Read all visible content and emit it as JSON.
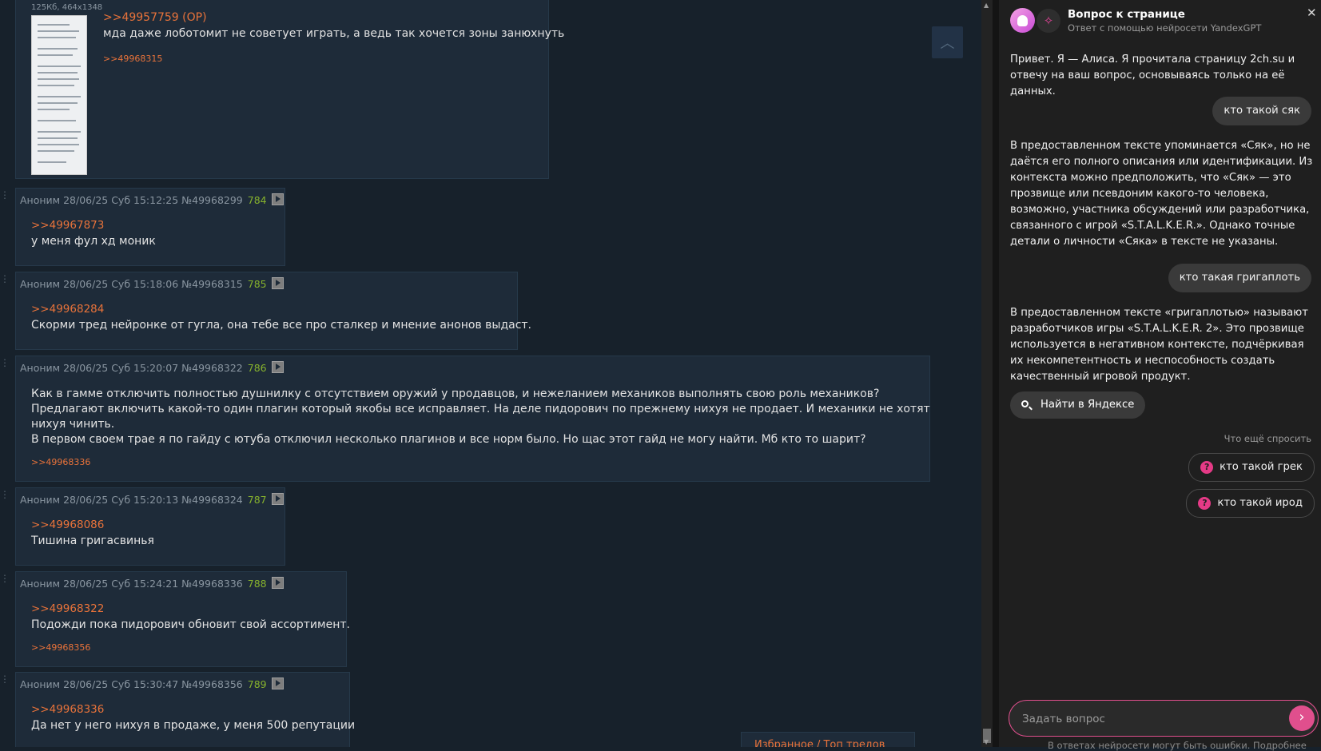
{
  "op_post": {
    "image_meta": "125Кб, 464x1348",
    "number": ">>49957759 (OP)",
    "message": "мда даже лоботомит не советует играть, а ведь так хочется зоны занюхнуть",
    "reply": ">>49968315"
  },
  "posts": [
    {
      "author": "Аноним",
      "date": "28/06/25 Суб 15:12:25",
      "num": "№49968299",
      "count": "784",
      "ref": ">>49967873",
      "lines": [
        "у меня фул хд моник"
      ],
      "reply": ""
    },
    {
      "author": "Аноним",
      "date": "28/06/25 Суб 15:18:06",
      "num": "№49968315",
      "count": "785",
      "ref": ">>49968284",
      "lines": [
        "Скорми тред нейронке от гугла, она тебе все про сталкер и мнение анонов выдаст."
      ],
      "reply": ""
    },
    {
      "author": "Аноним",
      "date": "28/06/25 Суб 15:20:07",
      "num": "№49968322",
      "count": "786",
      "ref": "",
      "lines": [
        "Как в гамме отключить полностью душнилку с отсутствием оружий у продавцов, и нежеланием механиков выполнять свою роль механиков?",
        "Предлагают включить какой-то один плагин который якобы все исправляет. На деле пидорович по прежнему нихуя не продает. И механики не хотят",
        "нихуя чинить.",
        "В первом своем трае я по гайду с ютуба отключил несколько плагинов и все норм было. Но щас этот гайд не могу найти. Мб кто то шарит?"
      ],
      "reply": ">>49968336"
    },
    {
      "author": "Аноним",
      "date": "28/06/25 Суб 15:20:13",
      "num": "№49968324",
      "count": "787",
      "ref": ">>49968086",
      "lines": [
        "Тишина григасвинья"
      ],
      "reply": ""
    },
    {
      "author": "Аноним",
      "date": "28/06/25 Суб 15:24:21",
      "num": "№49968336",
      "count": "788",
      "ref": ">>49968322",
      "lines": [
        "Подожди пока пидорович обновит свой ассортимент."
      ],
      "reply": ">>49968356"
    },
    {
      "author": "Аноним",
      "date": "28/06/25 Суб 15:30:47",
      "num": "№49968356",
      "count": "789",
      "ref": ">>49968336",
      "lines": [
        "Да нет у него нихуя в продаже, у меня 500 репутации"
      ],
      "reply": ""
    }
  ],
  "favorites_label": "Избранное / Топ тредов",
  "panel": {
    "title": "Вопрос к странице",
    "subtitle": "Ответ с помощью нейросети YandexGPT",
    "greeting": "Привет. Я — Алиса. Я прочитала страницу 2ch.su и отвечу на ваш вопрос, основываясь только на её данных.",
    "q1": "кто такой сяк",
    "a1": "В предоставленном тексте упоминается «Сяк», но не даётся его полного описания или идентификации. Из контекста можно предположить, что «Сяк» — это прозвище или псевдоним какого-то человека, возможно, участника обсуждений или разработчика, связанного с игрой «S.T.A.L.K.E.R.». Однако точные детали о личности «Сяка» в тексте не указаны.",
    "q2": "кто такая григаплоть",
    "a2": "В предоставленном тексте «григаплотью» называют разработчиков игры «S.T.A.L.K.E.R. 2». Это прозвище используется в негативном контексте, подчёркивая их некомпетентность и неспособность создать качественный игровой продукт.",
    "find_label": "Найти в Яндексе",
    "more_label": "Что ещё спросить",
    "suggestions": [
      "кто такой грек",
      "кто такой ирод"
    ],
    "ask_placeholder": "Задать вопрос",
    "disclaimer": "В ответах нейросети могут быть ошибки. Подробнее"
  }
}
